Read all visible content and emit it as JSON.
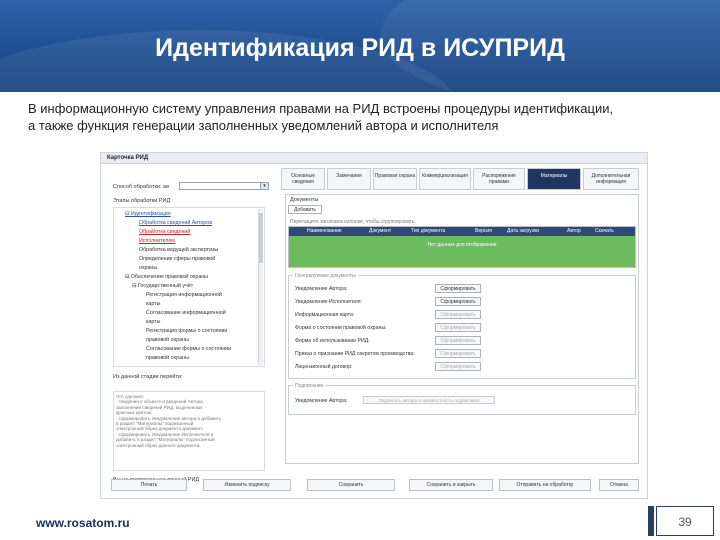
{
  "slide": {
    "title": "Идентификация РИД в ИСУПРИД",
    "intro_line1": "В информационную систему управления правами на РИД встроены процедуры идентификации,",
    "intro_line2": "а также функция генерации заполненных уведомлений автора и исполнителя",
    "footer_url": "www.rosatom.ru",
    "page_number": "39"
  },
  "app": {
    "window_title": "Карточка РИД",
    "left": {
      "type_label": "Способ обработки: ав",
      "tree_label": "Этапы обработки РИД",
      "tree": [
        {
          "text": "⊟ Идентификация",
          "style": "blue",
          "indent": 1
        },
        {
          "text": "Обработка сведений Авторов",
          "style": "blue",
          "indent": 3
        },
        {
          "text": "Обработка сведений",
          "style": "red",
          "indent": 3
        },
        {
          "text": "Исполнителем",
          "style": "red",
          "indent": 3
        },
        {
          "text": "Обработка ведущей экспертизы",
          "style": "",
          "indent": 3
        },
        {
          "text": "Определение сферы правовой",
          "style": "",
          "indent": 3
        },
        {
          "text": "охраны",
          "style": "",
          "indent": 3
        },
        {
          "text": "⊟ Обеспечение правовой охраны",
          "style": "",
          "indent": 1
        },
        {
          "text": "⊟ Государственный учёт",
          "style": "",
          "indent": 2
        },
        {
          "text": "Регистрация информационной",
          "style": "",
          "indent": 4
        },
        {
          "text": "карты",
          "style": "",
          "indent": 4
        },
        {
          "text": "Согласование информационной",
          "style": "",
          "indent": 4
        },
        {
          "text": "карты",
          "style": "",
          "indent": 4
        },
        {
          "text": "Регистрация формы о состоянии",
          "style": "",
          "indent": 4
        },
        {
          "text": "правовой охраны",
          "style": "",
          "indent": 4
        },
        {
          "text": "Согласование формы о состоянии",
          "style": "",
          "indent": 4
        },
        {
          "text": "правовой охраны",
          "style": "",
          "indent": 4
        }
      ],
      "current_stage_label": "Из данной стадии перейти:",
      "notes": [
        "Что сделано:",
        "- сведения о объекте и введений Автора,",
        "  заполнение сведений РИД, выделенных",
        "  красным цветом;",
        "- сформировать Уведомление автора и добавить",
        "  в раздел \"Материалы\" подписанный",
        "  электронный образ документа документ;",
        "- сформировать Уведомление Исполнителя и",
        "  добавить в раздел \"Материалы\" подписанный",
        "  электронный образ данного документа."
      ],
      "bottom_label": "Вы не подписаны на данный РИД"
    },
    "tabs": [
      {
        "label": "Основные сведения"
      },
      {
        "label": "Замечания"
      },
      {
        "label": "Правовая охрана"
      },
      {
        "label": "Коммерциализация"
      },
      {
        "label": "Распоряжение правами"
      },
      {
        "label": "Материалы",
        "active": true
      },
      {
        "label": "Дополнительная информация"
      }
    ],
    "docs": {
      "section_label": "Документы",
      "subtab": "Добавить",
      "hint": "Перетащите заголовок колонки, чтобы сгруппировать",
      "columns": [
        "Наименование",
        "Документ",
        "Тип документа",
        "Версия",
        "Дата загрузки",
        "Автор",
        "Скачать"
      ],
      "empty": "Нет данных для отображения"
    },
    "forms": {
      "section_title": "Генерируемые документы",
      "rows": [
        {
          "label": "Уведомление Автора:",
          "button": "Сформировать",
          "dim": false
        },
        {
          "label": "Уведомление Исполнителя:",
          "button": "Сформировать",
          "dim": false
        },
        {
          "label": "Информационная карта:",
          "button": "Сформировать",
          "dim": true
        },
        {
          "label": "Форма о состоянии правовой охраны:",
          "button": "Сформировать",
          "dim": true
        },
        {
          "label": "Форма об использовании РИД:",
          "button": "Сформировать",
          "dim": true
        },
        {
          "label": "Приказ о признании РИД секретом производства:",
          "button": "Сформировать",
          "dim": true
        },
        {
          "label": "Лицензионный договор:",
          "button": "Сформировать",
          "dim": true
        }
      ]
    },
    "signing": {
      "section_title": "Подписание",
      "label": "Уведомление Автора:",
      "field": "Подписать автора в неизвестность подписания"
    },
    "bottom_buttons": [
      {
        "label": "Печать"
      },
      {
        "label": "Изменить подписку"
      },
      {
        "label": "Сохранить"
      },
      {
        "label": "Сохранить и закрыть"
      },
      {
        "label": "Отправить на обработку"
      },
      {
        "label": "Отмена"
      }
    ]
  }
}
